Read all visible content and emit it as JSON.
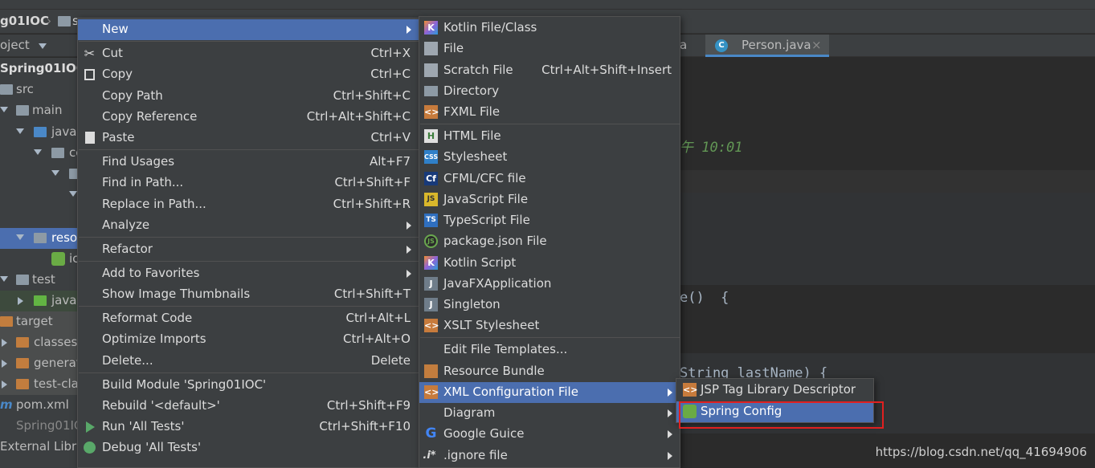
{
  "ide": {
    "breadcrumb": [
      "g01IOC",
      "s"
    ],
    "project_tool_label": "oject",
    "tree": [
      {
        "label": "Spring01IOC"
      },
      {
        "label": "src"
      },
      {
        "label": "main"
      },
      {
        "label": "java"
      },
      {
        "label": "co"
      },
      {
        "label": ""
      },
      {
        "label": ""
      },
      {
        "label": "reso"
      },
      {
        "label": "ic"
      },
      {
        "label": "test"
      },
      {
        "label": "java"
      },
      {
        "label": "target"
      },
      {
        "label": "classes"
      },
      {
        "label": "generat"
      },
      {
        "label": "test-cla"
      },
      {
        "label": "pom.xml"
      },
      {
        "label": "Spring01IO"
      },
      {
        "label": "External Librar"
      }
    ],
    "editor_tabs": [
      {
        "label": "a"
      },
      {
        "label": "Person.java"
      }
    ],
    "code": {
      "line_comment": "午 10:01",
      "line_method": "e()  {",
      "line_setter": "String lastName) {"
    },
    "watermark": "https://blog.csdn.net/qq_41694906"
  },
  "context_menu": {
    "items": [
      {
        "label": "New",
        "shortcut": "",
        "submenu": true,
        "icon": ""
      },
      {
        "label": "Cut",
        "shortcut": "Ctrl+X",
        "icon": "scissors-icon"
      },
      {
        "label": "Copy",
        "shortcut": "Ctrl+C",
        "icon": "copy-icon"
      },
      {
        "label": "Copy Path",
        "shortcut": "Ctrl+Shift+C"
      },
      {
        "label": "Copy Reference",
        "shortcut": "Ctrl+Alt+Shift+C"
      },
      {
        "label": "Paste",
        "shortcut": "Ctrl+V",
        "icon": "paste-icon"
      },
      {
        "label": "Find Usages",
        "shortcut": "Alt+F7"
      },
      {
        "label": "Find in Path...",
        "shortcut": "Ctrl+Shift+F"
      },
      {
        "label": "Replace in Path...",
        "shortcut": "Ctrl+Shift+R"
      },
      {
        "label": "Analyze",
        "shortcut": "",
        "submenu": true
      },
      {
        "label": "Refactor",
        "shortcut": "",
        "submenu": true
      },
      {
        "label": "Add to Favorites",
        "shortcut": "",
        "submenu": true
      },
      {
        "label": "Show Image Thumbnails",
        "shortcut": "Ctrl+Shift+T"
      },
      {
        "label": "Reformat Code",
        "shortcut": "Ctrl+Alt+L"
      },
      {
        "label": "Optimize Imports",
        "shortcut": "Ctrl+Alt+O"
      },
      {
        "label": "Delete...",
        "shortcut": "Delete"
      },
      {
        "label": "Build Module 'Spring01IOC'",
        "shortcut": ""
      },
      {
        "label": "Rebuild '<default>'",
        "shortcut": "Ctrl+Shift+F9"
      },
      {
        "label": "Run 'All Tests'",
        "shortcut": "Ctrl+Shift+F10",
        "icon": "run-icon"
      },
      {
        "label": "Debug 'All Tests'",
        "shortcut": "",
        "icon": "debug-icon"
      }
    ]
  },
  "new_submenu": {
    "items": [
      {
        "label": "Kotlin File/Class",
        "shortcut": "",
        "icon": "kotlin-icon"
      },
      {
        "label": "File",
        "shortcut": "",
        "icon": "file-icon"
      },
      {
        "label": "Scratch File",
        "shortcut": "Ctrl+Alt+Shift+Insert",
        "icon": "scratch-file-icon"
      },
      {
        "label": "Directory",
        "shortcut": "",
        "icon": "folder-icon"
      },
      {
        "label": "FXML File",
        "shortcut": "",
        "icon": "fxml-file-icon"
      },
      {
        "label": "HTML File",
        "shortcut": "",
        "icon": "html-file-icon"
      },
      {
        "label": "Stylesheet",
        "shortcut": "",
        "icon": "css-file-icon"
      },
      {
        "label": "CFML/CFC file",
        "shortcut": "",
        "icon": "cfml-file-icon"
      },
      {
        "label": "JavaScript File",
        "shortcut": "",
        "icon": "javascript-file-icon"
      },
      {
        "label": "TypeScript File",
        "shortcut": "",
        "icon": "typescript-file-icon"
      },
      {
        "label": "package.json File",
        "shortcut": "",
        "icon": "package-json-icon"
      },
      {
        "label": "Kotlin Script",
        "shortcut": "",
        "icon": "kotlin-script-icon"
      },
      {
        "label": "JavaFXApplication",
        "shortcut": "",
        "icon": "javafx-icon"
      },
      {
        "label": "Singleton",
        "shortcut": "",
        "icon": "singleton-icon"
      },
      {
        "label": "XSLT Stylesheet",
        "shortcut": "",
        "icon": "xslt-icon"
      },
      {
        "label": "Edit File Templates...",
        "shortcut": ""
      },
      {
        "label": "Resource Bundle",
        "shortcut": "",
        "icon": "resource-bundle-icon"
      },
      {
        "label": "XML Configuration File",
        "shortcut": "",
        "submenu": true,
        "icon": "xml-config-icon"
      },
      {
        "label": "Diagram",
        "shortcut": "",
        "submenu": true
      },
      {
        "label": "Google Guice",
        "shortcut": "",
        "submenu": true,
        "icon": "google-icon"
      },
      {
        "label": ".ignore file",
        "shortcut": "",
        "submenu": true,
        "icon": "ignore-file-icon"
      }
    ]
  },
  "xml_submenu": {
    "items": [
      {
        "label": "JSP Tag Library Descriptor",
        "icon": "jsp-tag-icon"
      },
      {
        "label": "Spring Config",
        "icon": "spring-icon"
      }
    ]
  },
  "icon_glyphs": {
    "scissors": "✂",
    "cf": "Cf",
    "js": "JS",
    "ts": "TS",
    "css": "CSS",
    "pkg": "JS",
    "google": "G",
    "ignore": ".i*",
    "xml": "<>",
    "html": "H",
    "java": "J",
    "kt": "K",
    "pom": "m"
  },
  "colors": {
    "selection": "#4b6eaf",
    "menu_bg": "#3c3f41",
    "highlight_box": "#e02020"
  }
}
